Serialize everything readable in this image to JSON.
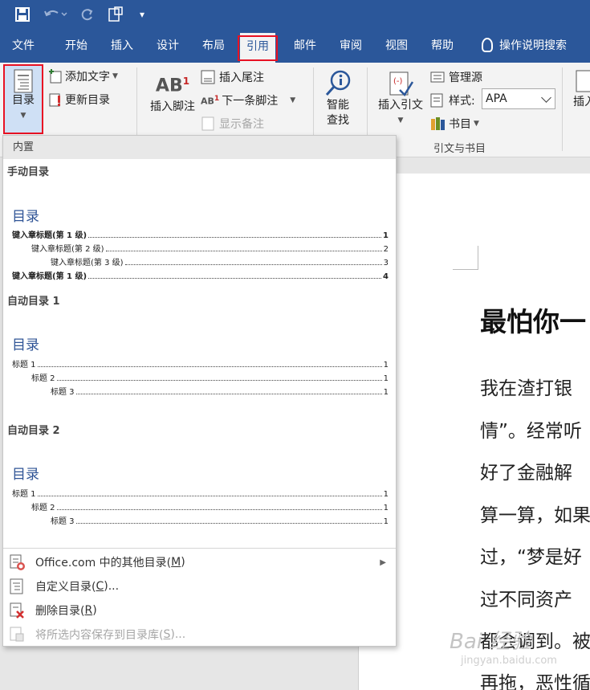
{
  "qat": {
    "save": "save-icon",
    "undo": "undo-icon",
    "redo": "redo-icon",
    "format": "format-painter-icon",
    "customize": "▾"
  },
  "tabs": [
    "文件",
    "开始",
    "插入",
    "设计",
    "布局",
    "引用",
    "邮件",
    "审阅",
    "视图",
    "帮助"
  ],
  "active_tab": "引用",
  "tell_me": "操作说明搜索",
  "ribbon": {
    "toc_label": "目录",
    "add_text": "添加文字",
    "update_toc": "更新目录",
    "insert_footnote": "插入脚注",
    "insert_endnote": "插入尾注",
    "next_footnote": "下一条脚注",
    "show_notes": "显示备注",
    "smart_lookup_1": "智能",
    "smart_lookup_2": "查找",
    "insert_citation_1": "插入引文",
    "manage_sources": "管理源",
    "style_label": "样式:",
    "style_value": "APA",
    "bibliography": "书目",
    "group_citations": "引文与书目",
    "insert_caption": "插入"
  },
  "dropdown": {
    "header": "内置",
    "sections": [
      {
        "name": "手动目录",
        "title": "目录",
        "entries": [
          {
            "text": "键入章标题(第 1 级)",
            "page": "1",
            "level": 1,
            "bold": true
          },
          {
            "text": "键入章标题(第 2 级)",
            "page": "2",
            "level": 2,
            "bold": false
          },
          {
            "text": "键入章标题(第 3 级)",
            "page": "3",
            "level": 3,
            "bold": false
          },
          {
            "text": "键入章标题(第 1 级)",
            "page": "4",
            "level": 1,
            "bold": true
          }
        ]
      },
      {
        "name": "自动目录 1",
        "title": "目录",
        "entries": [
          {
            "text": "标题 1",
            "page": "1",
            "level": 1,
            "bold": false
          },
          {
            "text": "标题 2",
            "page": "1",
            "level": 2,
            "bold": false
          },
          {
            "text": "标题 3",
            "page": "1",
            "level": 3,
            "bold": false
          }
        ]
      },
      {
        "name": "自动目录 2",
        "title": "目录",
        "entries": [
          {
            "text": "标题 1",
            "page": "1",
            "level": 1,
            "bold": false
          },
          {
            "text": "标题 2",
            "page": "1",
            "level": 2,
            "bold": false
          },
          {
            "text": "标题 3",
            "page": "1",
            "level": 3,
            "bold": false
          }
        ]
      }
    ],
    "menu": [
      {
        "pre": "Office.com 中的其他目录(",
        "key": "M",
        "post": ")",
        "icon": "office-toc-icon",
        "disabled": false,
        "submenu": true
      },
      {
        "pre": "自定义目录(",
        "key": "C",
        "post": ")...",
        "icon": "custom-toc-icon",
        "disabled": false,
        "submenu": false
      },
      {
        "pre": "删除目录(",
        "key": "R",
        "post": ")",
        "icon": "remove-toc-icon",
        "disabled": false,
        "submenu": false
      },
      {
        "pre": "将所选内容保存到目录库(",
        "key": "S",
        "post": ")...",
        "icon": "save-to-gallery-icon",
        "disabled": true,
        "submenu": false
      }
    ]
  },
  "document": {
    "title": "最怕你一",
    "lines": [
      "我在渣打银",
      "情”。经常听",
      "好了金融解",
      "算一算，如果",
      "过，“梦是好",
      "过不同资产",
      "都会调到。被",
      "再拖，恶性循"
    ]
  },
  "watermark": {
    "main": "Bai 经验",
    "sub": "jingyan.baidu.com"
  },
  "colors": {
    "brand": "#2b579a",
    "highlight": "#e81123",
    "toc_title": "#2f5496"
  }
}
